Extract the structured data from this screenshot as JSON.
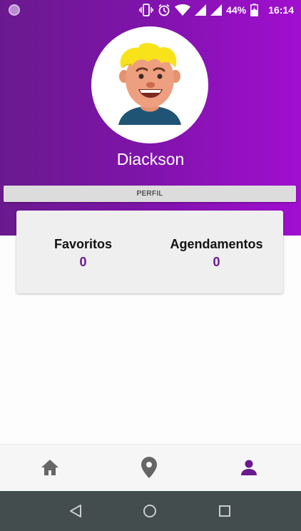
{
  "status_bar": {
    "battery_percent": "44%",
    "time": "16:14",
    "icons": [
      "app-indicator-icon",
      "vibrate-icon",
      "alarm-icon",
      "wifi-icon",
      "signal-icon",
      "signal-icon",
      "battery-charging-icon"
    ]
  },
  "profile": {
    "name": "Diackson",
    "avatar": "avatar-icon",
    "button_label": "PERFIL"
  },
  "stats": {
    "favorites_label": "Favoritos",
    "favorites_value": "0",
    "appointments_label": "Agendamentos",
    "appointments_value": "0"
  },
  "bottom_nav": {
    "items": [
      {
        "icon": "home-icon",
        "active": false
      },
      {
        "icon": "map-pin-icon",
        "active": false
      },
      {
        "icon": "person-icon",
        "active": true
      }
    ]
  },
  "system_nav": [
    "back-icon",
    "home-circle-icon",
    "recents-icon"
  ],
  "colors": {
    "primary": "#7d14a8",
    "accent_text": "#6a1a8e",
    "nav_inactive": "#666666",
    "system_nav_bg": "#434d4e"
  }
}
